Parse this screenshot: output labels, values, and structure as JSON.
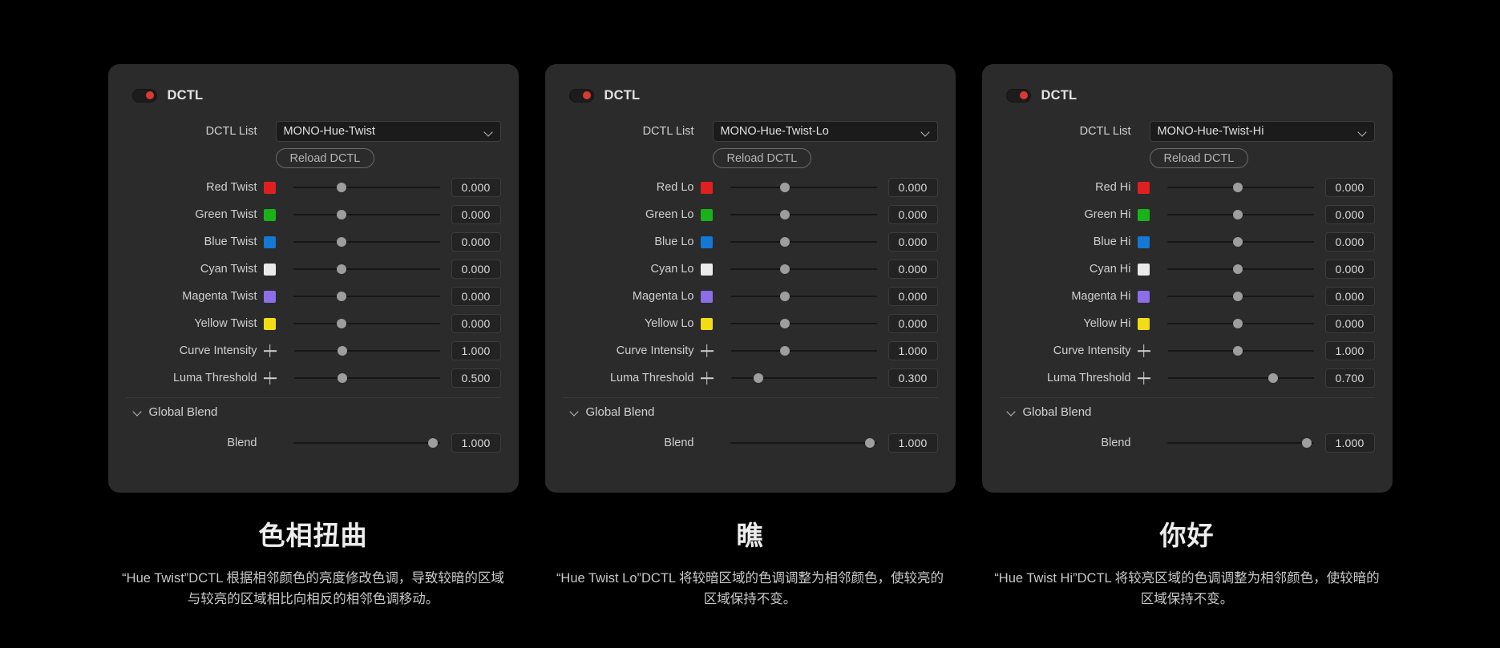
{
  "background": "#000000",
  "panel_bg": "#2b2b2b",
  "accent_toggle": "#d83a32",
  "panels": [
    {
      "toggle_on": true,
      "title": "DCTL",
      "dctl_list_label": "DCTL List",
      "dctl_list_value": "MONO-Hue-Twist",
      "reload_label": "Reload DCTL",
      "params": [
        {
          "label": "Red Twist",
          "icon": "color-swatch",
          "color": "#e02020",
          "value": "0.000",
          "pos": 0.333
        },
        {
          "label": "Green Twist",
          "icon": "color-swatch",
          "color": "#19b319",
          "value": "0.000",
          "pos": 0.333
        },
        {
          "label": "Blue Twist",
          "icon": "color-swatch",
          "color": "#1478d4",
          "value": "0.000",
          "pos": 0.333
        },
        {
          "label": "Cyan Twist",
          "icon": "color-swatch",
          "color": "#eaeaea",
          "value": "0.000",
          "pos": 0.333
        },
        {
          "label": "Magenta Twist",
          "icon": "color-swatch",
          "color": "#8b6ee8",
          "value": "0.000",
          "pos": 0.333
        },
        {
          "label": "Yellow Twist",
          "icon": "color-swatch",
          "color": "#f2dc16",
          "value": "0.000",
          "pos": 0.333
        },
        {
          "label": "Curve Intensity",
          "icon": "plus-icon",
          "color": "",
          "value": "1.000",
          "pos": 0.333
        },
        {
          "label": "Luma Threshold",
          "icon": "plus-icon",
          "color": "",
          "value": "0.500",
          "pos": 0.333
        }
      ],
      "section": {
        "label": "Global Blend",
        "expanded": true
      },
      "blend": {
        "label": "Blend",
        "value": "1.000",
        "pos": 0.955
      },
      "caption_title": "色相扭曲",
      "caption_body": "“Hue Twist”DCTL 根据相邻颜色的亮度修改色调，导致较暗的区域与较亮的区域相比向相反的相邻色调移动。"
    },
    {
      "toggle_on": true,
      "title": "DCTL",
      "dctl_list_label": "DCTL List",
      "dctl_list_value": "MONO-Hue-Twist-Lo",
      "reload_label": "Reload DCTL",
      "params": [
        {
          "label": "Red Lo",
          "icon": "color-swatch",
          "color": "#e02020",
          "value": "0.000",
          "pos": 0.372
        },
        {
          "label": "Green Lo",
          "icon": "color-swatch",
          "color": "#19b319",
          "value": "0.000",
          "pos": 0.372
        },
        {
          "label": "Blue Lo",
          "icon": "color-swatch",
          "color": "#1478d4",
          "value": "0.000",
          "pos": 0.372
        },
        {
          "label": "Cyan Lo",
          "icon": "color-swatch",
          "color": "#eaeaea",
          "value": "0.000",
          "pos": 0.372
        },
        {
          "label": "Magenta Lo",
          "icon": "color-swatch",
          "color": "#8b6ee8",
          "value": "0.000",
          "pos": 0.372
        },
        {
          "label": "Yellow Lo",
          "icon": "color-swatch",
          "color": "#f2dc16",
          "value": "0.000",
          "pos": 0.372
        },
        {
          "label": "Curve Intensity",
          "icon": "plus-icon",
          "color": "",
          "value": "1.000",
          "pos": 0.372
        },
        {
          "label": "Luma Threshold",
          "icon": "plus-icon",
          "color": "",
          "value": "0.300",
          "pos": 0.188
        }
      ],
      "section": {
        "label": "Global Blend",
        "expanded": true
      },
      "blend": {
        "label": "Blend",
        "value": "1.000",
        "pos": 0.955
      },
      "caption_title": "瞧",
      "caption_body": "“Hue Twist Lo”DCTL 将较暗区域的色调调整为相邻颜色，使较亮的区域保持不变。"
    },
    {
      "toggle_on": true,
      "title": "DCTL",
      "dctl_list_label": "DCTL List",
      "dctl_list_value": "MONO-Hue-Twist-Hi",
      "reload_label": "Reload DCTL",
      "params": [
        {
          "label": "Red Hi",
          "icon": "color-swatch",
          "color": "#e02020",
          "value": "0.000",
          "pos": 0.482
        },
        {
          "label": "Green Hi",
          "icon": "color-swatch",
          "color": "#19b319",
          "value": "0.000",
          "pos": 0.482
        },
        {
          "label": "Blue Hi",
          "icon": "color-swatch",
          "color": "#1478d4",
          "value": "0.000",
          "pos": 0.482
        },
        {
          "label": "Cyan Hi",
          "icon": "color-swatch",
          "color": "#eaeaea",
          "value": "0.000",
          "pos": 0.482
        },
        {
          "label": "Magenta Hi",
          "icon": "color-swatch",
          "color": "#8b6ee8",
          "value": "0.000",
          "pos": 0.482
        },
        {
          "label": "Yellow Hi",
          "icon": "color-swatch",
          "color": "#f2dc16",
          "value": "0.000",
          "pos": 0.482
        },
        {
          "label": "Curve Intensity",
          "icon": "plus-icon",
          "color": "",
          "value": "1.000",
          "pos": 0.482
        },
        {
          "label": "Luma Threshold",
          "icon": "plus-icon",
          "color": "",
          "value": "0.700",
          "pos": 0.725
        }
      ],
      "section": {
        "label": "Global Blend",
        "expanded": true
      },
      "blend": {
        "label": "Blend",
        "value": "1.000",
        "pos": 0.955
      },
      "caption_title": "你好",
      "caption_body": "“Hue Twist Hi”DCTL 将较亮区域的色调调整为相邻颜色，使较暗的区域保持不变。"
    }
  ]
}
